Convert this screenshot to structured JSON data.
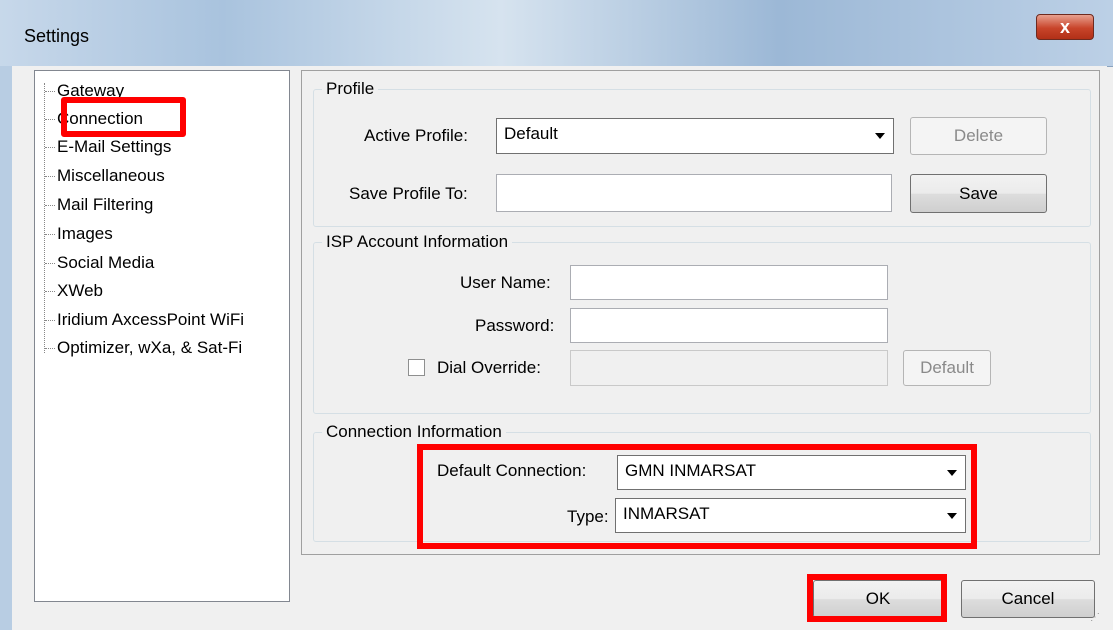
{
  "window": {
    "title": "Settings",
    "close_label": "x"
  },
  "tree": {
    "items": [
      "Gateway",
      "Connection",
      "E-Mail Settings",
      "Miscellaneous",
      "Mail Filtering",
      "Images",
      "Social Media",
      "XWeb",
      "Iridium AxcessPoint WiFi",
      "Optimizer, wXa, & Sat-Fi"
    ],
    "selected": "Connection"
  },
  "profile": {
    "group_label": "Profile",
    "active_profile_label": "Active Profile:",
    "active_profile_value": "Default",
    "delete_label": "Delete",
    "save_to_label": "Save Profile To:",
    "save_to_value": "",
    "save_label": "Save"
  },
  "isp": {
    "group_label": "ISP Account Information",
    "username_label": "User Name:",
    "username_value": "",
    "password_label": "Password:",
    "password_value": "",
    "dial_override_label": "Dial Override:",
    "dial_override_checked": false,
    "dial_override_value": "",
    "default_label": "Default"
  },
  "connection": {
    "group_label": "Connection Information",
    "default_connection_label": "Default Connection:",
    "default_connection_value": "GMN INMARSAT",
    "type_label": "Type:",
    "type_value": "INMARSAT"
  },
  "footer": {
    "ok_label": "OK",
    "cancel_label": "Cancel"
  },
  "colors": {
    "highlight": "#ff0000",
    "close_button": "#c8442a"
  }
}
